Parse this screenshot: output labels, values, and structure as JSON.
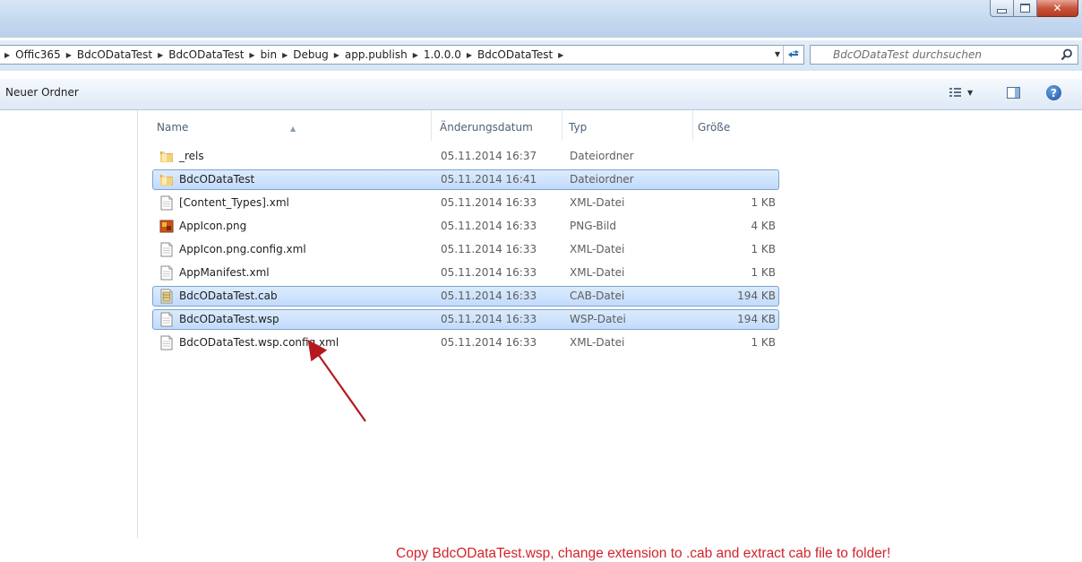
{
  "window": {
    "title_buttons": {
      "minimize": "minimize-icon",
      "maximize": "maximize-icon",
      "close": "✕"
    }
  },
  "address": {
    "segments": [
      "Offic365",
      "BdcODataTest",
      "BdcODataTest",
      "bin",
      "Debug",
      "app.publish",
      "1.0.0.0",
      "BdcODataTest"
    ],
    "search_placeholder": "BdcODataTest durchsuchen"
  },
  "toolbar": {
    "new_folder": "Neuer Ordner"
  },
  "columns": {
    "name": "Name",
    "date": "Änderungsdatum",
    "type": "Typ",
    "size": "Größe"
  },
  "files": [
    {
      "name": "_rels",
      "date": "05.11.2014 16:37",
      "type": "Dateiordner",
      "size": "",
      "icon": "folder-icon",
      "selected": false
    },
    {
      "name": "BdcODataTest",
      "date": "05.11.2014 16:41",
      "type": "Dateiordner",
      "size": "",
      "icon": "folder-icon",
      "selected": true
    },
    {
      "name": "[Content_Types].xml",
      "date": "05.11.2014 16:33",
      "type": "XML-Datei",
      "size": "1 KB",
      "icon": "document-icon",
      "selected": false
    },
    {
      "name": "AppIcon.png",
      "date": "05.11.2014 16:33",
      "type": "PNG-Bild",
      "size": "4 KB",
      "icon": "image-file-icon",
      "selected": false
    },
    {
      "name": "AppIcon.png.config.xml",
      "date": "05.11.2014 16:33",
      "type": "XML-Datei",
      "size": "1 KB",
      "icon": "document-icon",
      "selected": false
    },
    {
      "name": "AppManifest.xml",
      "date": "05.11.2014 16:33",
      "type": "XML-Datei",
      "size": "1 KB",
      "icon": "document-icon",
      "selected": false
    },
    {
      "name": "BdcODataTest.cab",
      "date": "05.11.2014 16:33",
      "type": "CAB-Datei",
      "size": "194 KB",
      "icon": "cab-archive-icon",
      "selected": true
    },
    {
      "name": "BdcODataTest.wsp",
      "date": "05.11.2014 16:33",
      "type": "WSP-Datei",
      "size": "194 KB",
      "icon": "document-icon",
      "selected": true
    },
    {
      "name": "BdcODataTest.wsp.config.xml",
      "date": "05.11.2014 16:33",
      "type": "XML-Datei",
      "size": "1 KB",
      "icon": "document-icon",
      "selected": false
    }
  ],
  "annotation": {
    "text": "Copy BdcODataTest.wsp, change extension to .cab and extract cab file to folder!",
    "color": "#d2232a"
  },
  "colors": {
    "selection": "#c1dbfc",
    "selection_border": "#7da2ce",
    "chrome": "#d6e5f5"
  }
}
